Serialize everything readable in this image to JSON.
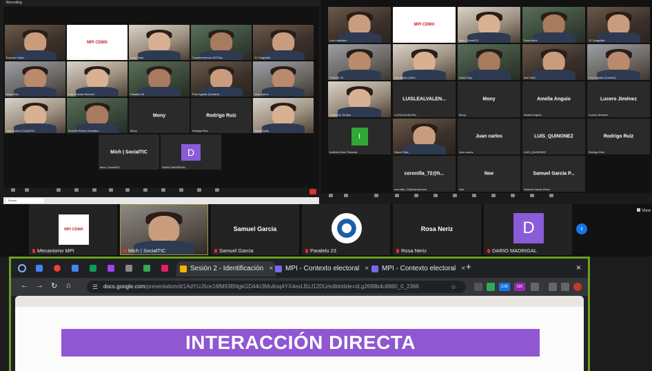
{
  "left_meeting": {
    "recording_label": "Recording",
    "tiles": [
      {
        "name": "Ernesto Yáñez"
      },
      {
        "name": "Mecanismo MPI",
        "logo": "MPI CDMX"
      },
      {
        "name": "Karla Trejo"
      },
      {
        "name": "Transformemos CETRAL"
      },
      {
        "name": "JC Delgadillo"
      },
      {
        "name": "Mary Díaz"
      },
      {
        "name": "Luis Ernesto Ramírez"
      },
      {
        "name": "Paralelo 23"
      },
      {
        "name": "Paul Aguilar (Conafor)"
      },
      {
        "name": "Juan carlos"
      },
      {
        "name": "Luis Guerra | SocialTIC"
      },
      {
        "name": "Rodolfo Rivera González"
      },
      {
        "name": "Mony",
        "label": "Mony"
      },
      {
        "name": "Rodrigo Ruiz",
        "label": "Rodrigo Ruiz"
      },
      {
        "name": "Dasia Ayala"
      },
      {
        "name": "Mich | SocialTIC",
        "label": "Mich | SocialTIC"
      },
      {
        "name": "DARIO MADRIGAL",
        "initial": "D"
      }
    ],
    "search_placeholder": "Buscar"
  },
  "right_meeting": {
    "tiles": [
      {
        "name": "Luis Lealvalen"
      },
      {
        "name": "Mecanismo MPI",
        "logo": "MPI CDMX"
      },
      {
        "name": "Mich | SocialTIC"
      },
      {
        "name": "Rosa Neriz"
      },
      {
        "name": "JC Delgadillo"
      },
      {
        "name": "Paralelo 23"
      },
      {
        "name": "Luis Ibarra | Mich"
      },
      {
        "name": "Karla Trejo"
      },
      {
        "name": "Itzel Soto"
      },
      {
        "name": "Paul Aguilar (Conafor)"
      },
      {
        "name": "Guillermo Torrijos"
      },
      {
        "name": "LUISLEALVALEN...",
        "label": "LUISLEALVALEN..."
      },
      {
        "name": "Mony",
        "label": "Mony"
      },
      {
        "name": "Amelia Anguio",
        "label": "Amelia Anguio"
      },
      {
        "name": "Lucero Jiménez",
        "label": "Lucero Jiménez"
      },
      {
        "name": "Instituto Elect Tlaxcala",
        "initial": "I"
      },
      {
        "name": "Diana Frias"
      },
      {
        "name": "Juan carlos",
        "label": "Juan carlos"
      },
      {
        "name": "LUIS_QUINONEZ",
        "label": "LUIS_QUINONEZ"
      },
      {
        "name": "Rodrigo Ruiz",
        "label": "Rodrigo Ruiz"
      },
      {
        "name": "coronilla_72@hotmail.com",
        "label": "coronilla_72@h..."
      },
      {
        "name": "Noe",
        "label": "Noe"
      },
      {
        "name": "Samuel Garcia Pérez",
        "label": "Samuel Garcia P..."
      }
    ]
  },
  "gallery_strip": {
    "tiles": [
      {
        "name": "Mecanismo MPI",
        "kind": "logo",
        "logo_text": "MPI CDMX"
      },
      {
        "name": "Mich | SocialTIC",
        "kind": "video",
        "active": true
      },
      {
        "name": "Samuel Garcia",
        "kind": "label",
        "label": "Samuel Garcia"
      },
      {
        "name": "Paralelo 23",
        "kind": "emblem"
      },
      {
        "name": "Rosa Neriz",
        "kind": "label",
        "label": "Rosa Neriz"
      },
      {
        "name": "DARIO MADRIGAL",
        "kind": "initial",
        "initial": "D"
      }
    ],
    "next_icon": "›",
    "view_label": "View"
  },
  "browser": {
    "tabs": [
      {
        "label": "Sesión 2 - Identificación",
        "active": true,
        "fav_color": "#f4b400"
      },
      {
        "label": "MPI - Contexto electoral",
        "active": false,
        "fav_color": "#7b68ee"
      },
      {
        "label": "MPI - Contexto electoral",
        "active": false,
        "fav_color": "#7b68ee"
      }
    ],
    "url_host": "docs.google.com",
    "url_path": "/presentation/d/1AdYUJ5ce16fM93BNgkGD44n3Mu6oq4YX4exLBzJ12DU/edit#slide=id.g2698b4c8860_0_2366",
    "ext_badges": [
      "3.36",
      "325"
    ],
    "close_glyph": "×",
    "newtab_glyph": "+",
    "colors": {
      "accent_frame": "#6aa122",
      "slide_banner": "#8f57d2"
    }
  },
  "slide": {
    "title": "INTERACCIÓN DIRECTA"
  }
}
